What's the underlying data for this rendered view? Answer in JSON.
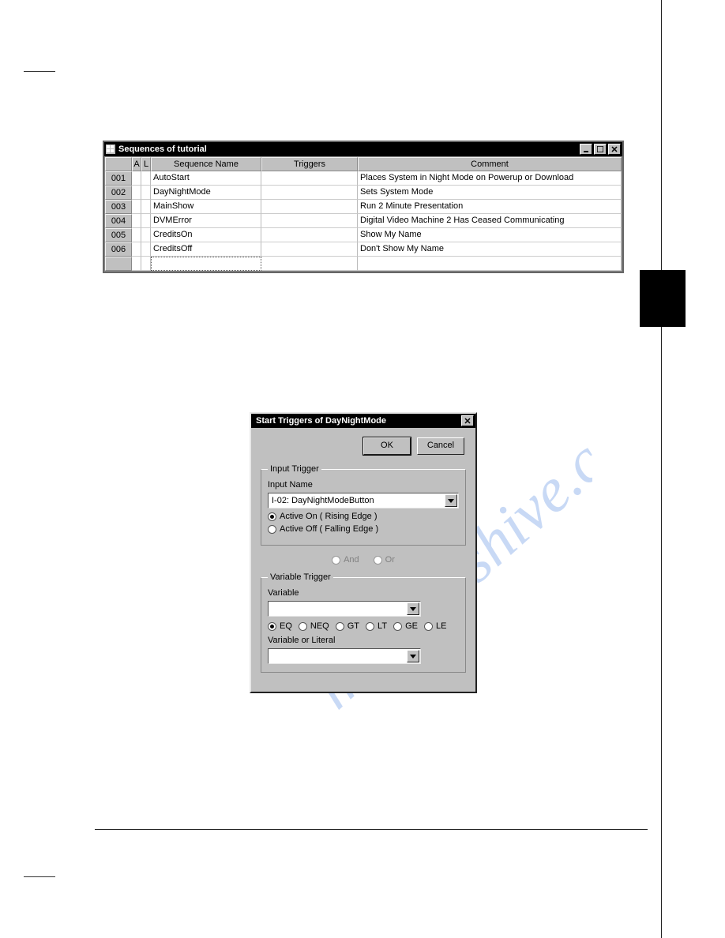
{
  "seqWindow": {
    "title": "Sequences of tutorial",
    "headers": {
      "a": "A",
      "l": "L",
      "name": "Sequence Name",
      "triggers": "Triggers",
      "comment": "Comment"
    },
    "rows": [
      {
        "num": "001",
        "name": "AutoStart",
        "triggers": "",
        "comment": "Places System in Night Mode on Powerup or Download"
      },
      {
        "num": "002",
        "name": "DayNightMode",
        "triggers": "",
        "comment": "Sets System Mode"
      },
      {
        "num": "003",
        "name": "MainShow",
        "triggers": "",
        "comment": "Run 2 Minute Presentation"
      },
      {
        "num": "004",
        "name": "DVMError",
        "triggers": "",
        "comment": "Digital Video Machine 2 Has Ceased Communicating"
      },
      {
        "num": "005",
        "name": "CreditsOn",
        "triggers": "",
        "comment": "Show My Name"
      },
      {
        "num": "006",
        "name": "CreditsOff",
        "triggers": "",
        "comment": "Don't Show My Name"
      }
    ]
  },
  "dialog": {
    "title": "Start Triggers of DayNightMode",
    "ok": "OK",
    "cancel": "Cancel",
    "inputTrigger": {
      "legend": "Input Trigger",
      "inputNameLabel": "Input Name",
      "inputNameValue": "I-02: DayNightModeButton",
      "activeOn": "Active On ( Rising Edge )",
      "activeOff": "Active Off ( Falling Edge )"
    },
    "andor": {
      "and": "And",
      "or": "Or"
    },
    "variableTrigger": {
      "legend": "Variable Trigger",
      "variableLabel": "Variable",
      "variableValue": "",
      "ops": {
        "eq": "EQ",
        "neq": "NEQ",
        "gt": "GT",
        "lt": "LT",
        "ge": "GE",
        "le": "LE"
      },
      "varOrLiteralLabel": "Variable or Literal",
      "varOrLiteralValue": ""
    }
  },
  "watermark": "manualshive.com"
}
